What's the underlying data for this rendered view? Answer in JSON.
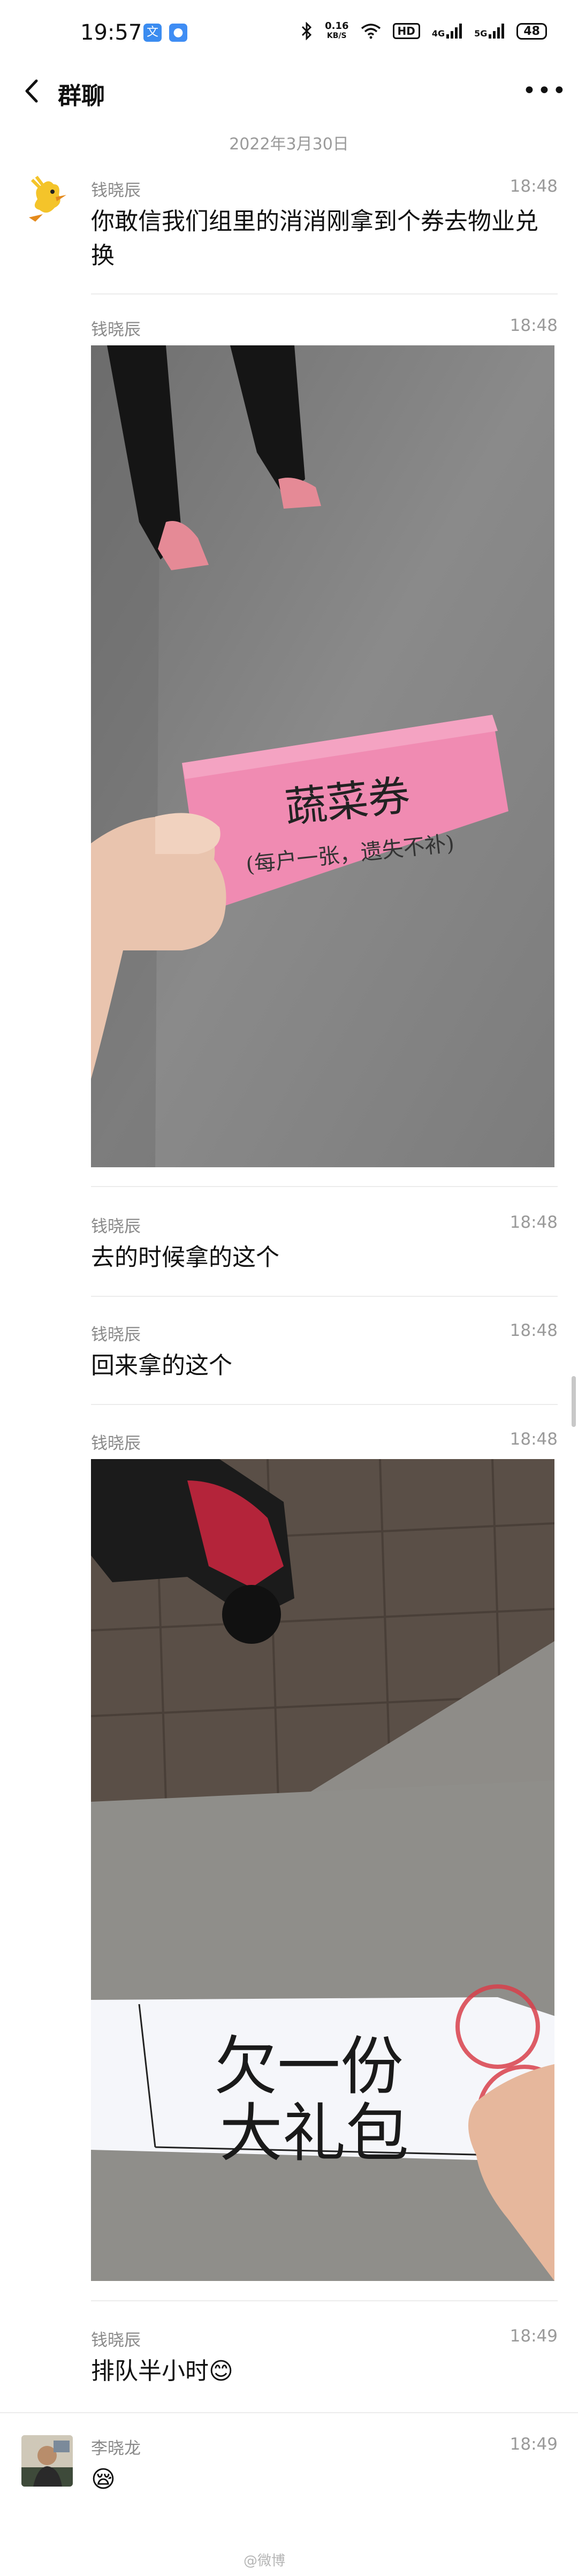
{
  "status_bar": {
    "time": "19:57",
    "app_icon_1": "文",
    "net_speed_value": "0.16",
    "net_speed_unit": "KB/S",
    "hd_badge": "HD",
    "signal_1": "4G",
    "signal_2": "5G",
    "battery": "48",
    "icons": [
      "bluetooth-icon",
      "wifi-icon",
      "signal-icon",
      "signal-icon",
      "battery-icon"
    ]
  },
  "header": {
    "title": "群聊",
    "back_icon": "chevron-left-icon",
    "more_icon": "more-dots-icon"
  },
  "date_divider": "2022年3月30日",
  "messages": [
    {
      "sender": "钱晓辰",
      "time": "18:48",
      "text": "你敢信我们组里的消消刚拿到个券去物业兑换"
    },
    {
      "sender": "钱晓辰",
      "time": "18:48",
      "image_text": "蔬菜券",
      "image_subtext": "(每户一张，遗失不补)"
    },
    {
      "sender": "钱晓辰",
      "time": "18:48",
      "text": "去的时候拿的这个"
    },
    {
      "sender": "钱晓辰",
      "time": "18:48",
      "text": "回来拿的这个"
    },
    {
      "sender": "钱晓辰",
      "time": "18:48",
      "image_text_line1": "欠一份",
      "image_text_line2": "大礼包"
    },
    {
      "sender": "钱晓辰",
      "time": "18:49",
      "text": "排队半小时😊"
    },
    {
      "sender": "李晓龙",
      "time": "18:49",
      "text": "😪"
    }
  ],
  "watermark": "@微博"
}
